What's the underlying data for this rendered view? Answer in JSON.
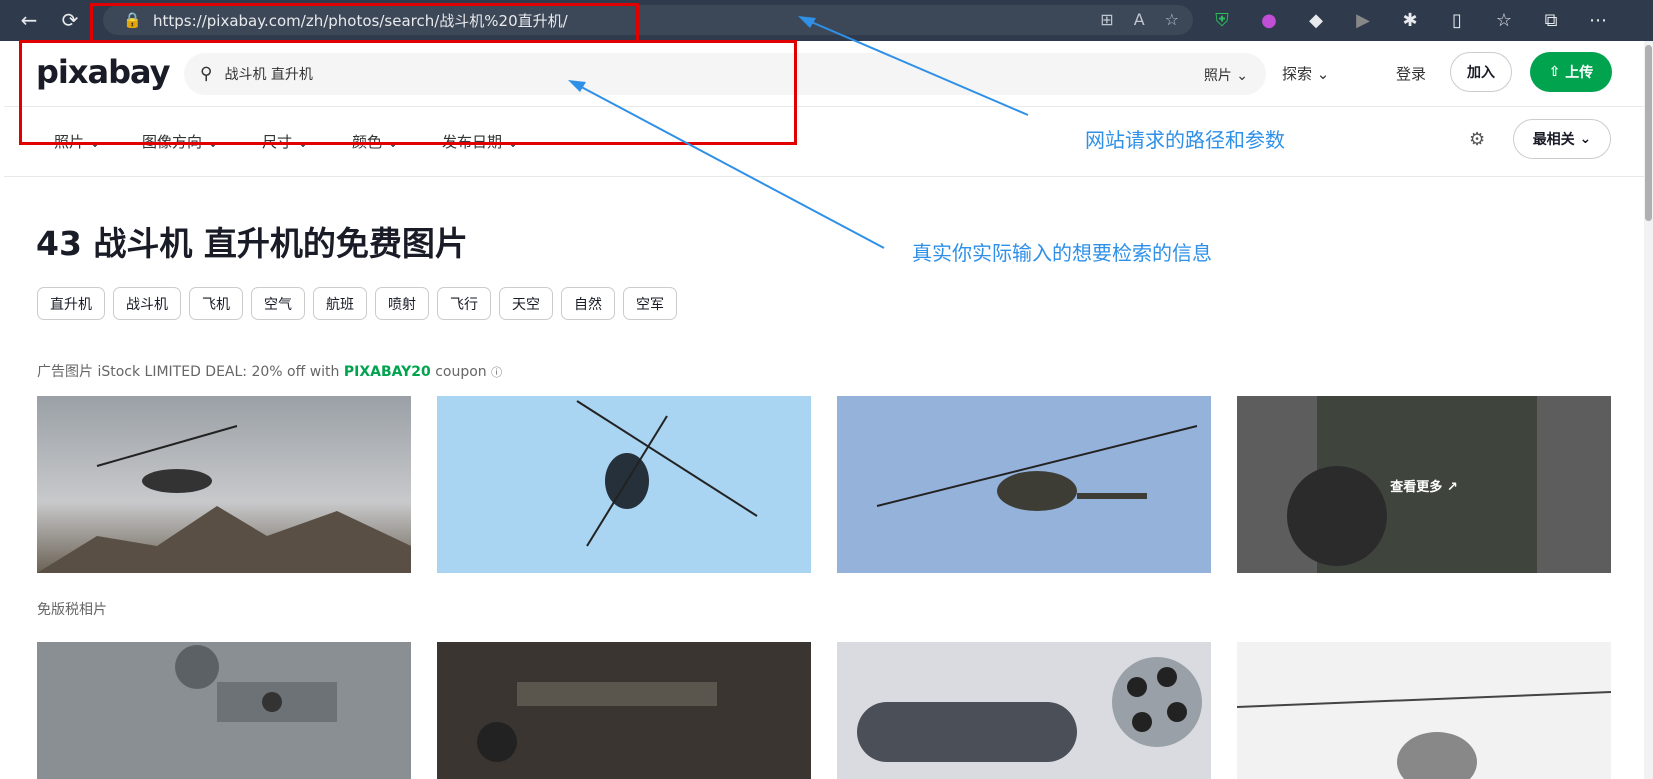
{
  "browser": {
    "url": "https://pixabay.com/zh/photos/search/战斗机%20直升机/"
  },
  "header": {
    "logo": "pixabay",
    "search_value": "战斗机 直升机",
    "search_type": "照片",
    "explore": "探索",
    "login": "登录",
    "join": "加入",
    "upload": "上传"
  },
  "filters": {
    "items": [
      "照片",
      "图像方向",
      "尺寸",
      "颜色",
      "发布日期"
    ],
    "sort": "最相关"
  },
  "main": {
    "title": "43 战斗机 直升机的免费图片",
    "tags": [
      "直升机",
      "战斗机",
      "飞机",
      "空气",
      "航班",
      "喷射",
      "飞行",
      "天空",
      "自然",
      "空军"
    ],
    "ad_prefix": "广告图片 iStock LIMITED DEAL: 20% off with ",
    "ad_code": "PIXABAY20",
    "ad_suffix": " coupon",
    "see_more": "查看更多",
    "section_label": "免版税相片"
  },
  "annotations": {
    "url_note": "网站请求的路径和参数",
    "search_note": "真实你实际输入的想要检索的信息"
  },
  "colors": {
    "brand_green": "#02a34f",
    "annotation_blue": "#2f90e8",
    "highlight_red": "#e00000"
  }
}
